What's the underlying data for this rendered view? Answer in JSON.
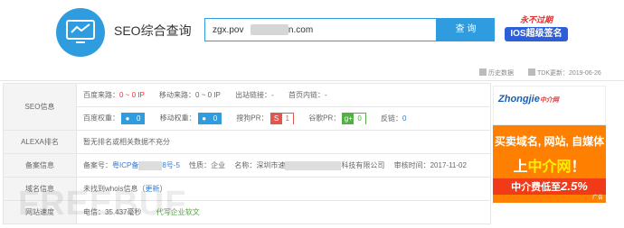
{
  "header": {
    "title": "SEO综合查询",
    "search_value": "zgx.pov      ercdn.com",
    "search_button": "查 询",
    "promo_line1": "永不过期",
    "promo_line2": "IOS超级签名"
  },
  "toolbar": {
    "history": "历史数据",
    "tdk": "TDK更新：2019-06-26"
  },
  "seo": {
    "label": "SEO信息",
    "baidu_source_label": "百度来路：",
    "baidu_source_value": "0 ~ 0 IP",
    "mobile_source_label": "移动来路：",
    "mobile_source_value": "0 ~ 0 IP",
    "outlinks_label": "出站链接：",
    "outlinks_value": "-",
    "home_links_label": "首页内链：",
    "home_links_value": "-",
    "baidu_weight_label": "百度权重：",
    "baidu_weight_value": "0",
    "mobile_weight_label": "移动权重：",
    "mobile_weight_value": "0",
    "sogou_pr_label": "搜狗PR：",
    "sogou_pr_value": "1",
    "google_pr_label": "谷歌PR：",
    "google_pr_value": "0",
    "backlinks_label": "反链：",
    "backlinks_value": "0"
  },
  "alexa": {
    "label": "ALEXA排名",
    "value": "暂无排名或相关数据不充分"
  },
  "icp": {
    "label": "备案信息",
    "number_label": "备案号：",
    "number_prefix": "粤ICP备",
    "number_suffix": "8号-5",
    "nature_label": "性质：",
    "nature_value": "企业",
    "name_label": "名称：",
    "name_prefix": "深圳市速",
    "name_suffix": "科技有限公司",
    "date_label": "审核时间：",
    "date_value": "2017-11-02"
  },
  "domain": {
    "label": "域名信息",
    "value": "未找到whois信息（",
    "update": "更新",
    "close": "）"
  },
  "speed": {
    "label": "网站速度",
    "telecom_label": "电信：",
    "telecom_value": "35.437毫秒",
    "ad_text": "代写企业软文"
  },
  "ad": {
    "brand": "Zhongjie",
    "brand_suffix": "中介网",
    "line1": "买卖域名, 网站, 自媒体",
    "line2_pre": "上",
    "line2_main": "中介网",
    "line2_post": "！",
    "line3_pre": "中介费低至",
    "line3_value": "2.5%",
    "ad_mark": "广告"
  },
  "watermark": "FREEBUF"
}
